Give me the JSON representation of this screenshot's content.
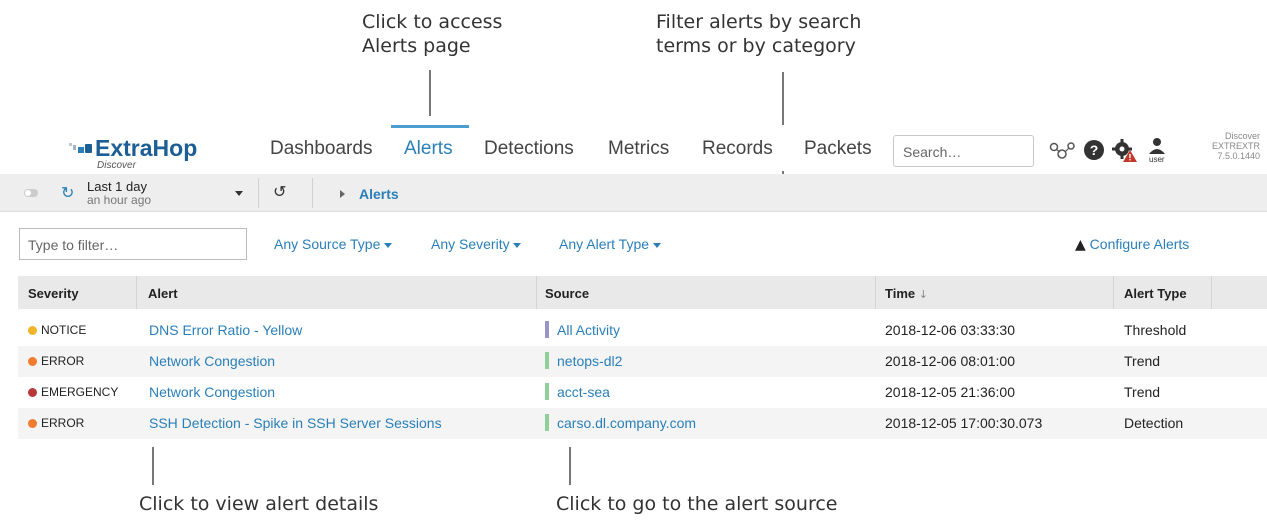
{
  "callouts": {
    "alerts_page_line1": "Click to access",
    "alerts_page_line2": "Alerts page",
    "filter_line1": "Filter alerts by search",
    "filter_line2": "terms or by category",
    "view_details": "Click to view alert details",
    "go_source": "Click to go to the alert source"
  },
  "brand": {
    "name": "ExtraHop",
    "sub": "Discover"
  },
  "nav": {
    "dashboards": "Dashboards",
    "alerts": "Alerts",
    "detections": "Detections",
    "metrics": "Metrics",
    "records": "Records",
    "packets": "Packets"
  },
  "search": {
    "placeholder": "Search…"
  },
  "user": {
    "label": "user"
  },
  "appliance": {
    "line1": "Discover",
    "line2": "EXTREXTR",
    "line3": "7.5.0.1440"
  },
  "toolbar": {
    "time_range": "Last 1 day",
    "time_sub": "an hour ago",
    "breadcrumb": "Alerts"
  },
  "filters": {
    "placeholder": "Type to filter…",
    "source_type": "Any Source Type",
    "severity": "Any Severity",
    "alert_type": "Any Alert Type",
    "configure": "Configure Alerts"
  },
  "columns": {
    "severity": "Severity",
    "alert": "Alert",
    "source": "Source",
    "time": "Time",
    "time_sort": "↓",
    "alert_type": "Alert Type"
  },
  "rows": [
    {
      "severity": "NOTICE",
      "alert": "DNS Error Ratio - Yellow",
      "source": "All Activity",
      "time": "2018-12-06 03:33:30",
      "type": "Threshold",
      "sev_color": "#f0b429",
      "src_color": "#9a95c9"
    },
    {
      "severity": "ERROR",
      "alert": "Network Congestion",
      "source": "netops-dl2",
      "time": "2018-12-06 08:01:00",
      "type": "Trend",
      "sev_color": "#f07a2e",
      "src_color": "#8fcf9c"
    },
    {
      "severity": "EMERGENCY",
      "alert": "Network Congestion",
      "source": "acct-sea",
      "time": "2018-12-05 21:36:00",
      "type": "Trend",
      "sev_color": "#b8383a",
      "src_color": "#8fcf9c"
    },
    {
      "severity": "ERROR",
      "alert": "SSH Detection - Spike in SSH Server Sessions",
      "source": "carso.dl.company.com",
      "time": "2018-12-05 17:00:30.073",
      "type": "Detection",
      "sev_color": "#f07a2e",
      "src_color": "#8fcf9c"
    }
  ]
}
